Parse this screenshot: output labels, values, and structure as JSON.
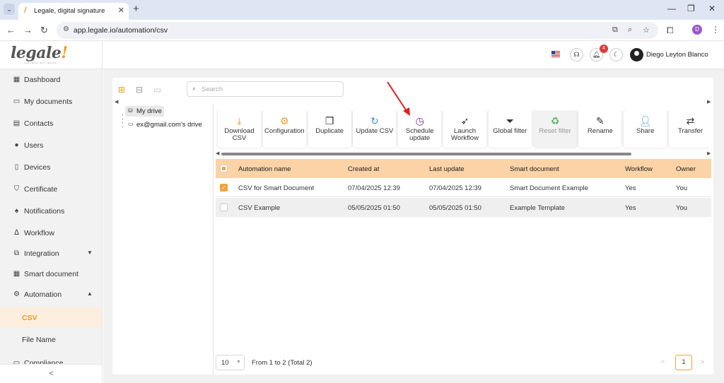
{
  "browser": {
    "tab_title": "Legale, digital signature",
    "url": "app.legale.io/automation/csv",
    "profile_initial": "D"
  },
  "header": {
    "logo_text": "legale",
    "logo_tagline": "THE LEGAL WAY LEGALE",
    "notification_count": "4",
    "user_name": "Diego Leyton Blanco"
  },
  "sidebar": {
    "items": [
      {
        "label": "Dashboard",
        "icon": "dashboard-icon"
      },
      {
        "label": "My documents",
        "icon": "folder-icon"
      },
      {
        "label": "Contacts",
        "icon": "contacts-icon"
      },
      {
        "label": "Users",
        "icon": "user-icon"
      },
      {
        "label": "Devices",
        "icon": "device-icon"
      },
      {
        "label": "Certificate",
        "icon": "shield-icon"
      },
      {
        "label": "Notifications",
        "icon": "bell-icon"
      },
      {
        "label": "Workflow",
        "icon": "workflow-icon"
      },
      {
        "label": "Integration",
        "icon": "integration-icon"
      },
      {
        "label": "Smart document",
        "icon": "smart-document-icon"
      },
      {
        "label": "Automation",
        "icon": "gear-icon"
      }
    ],
    "sub_items": [
      {
        "label": "CSV",
        "active": true
      },
      {
        "label": "File Name",
        "active": false
      }
    ],
    "last_item": "Compliance",
    "collapse_glyph": "<"
  },
  "main": {
    "search_placeholder": "Search",
    "tree": {
      "root": "My drive",
      "child": "ex@gmail.com's drive"
    },
    "toolbar": [
      {
        "label": "Download CSV",
        "icon": "download-icon",
        "color": "#f29a1f",
        "enabled": true
      },
      {
        "label": "Configuration",
        "icon": "settings-icon",
        "color": "#f29a1f",
        "enabled": true
      },
      {
        "label": "Duplicate",
        "icon": "copy-icon",
        "color": "#333333",
        "enabled": true
      },
      {
        "label": "Update CSV",
        "icon": "refresh-icon",
        "color": "#3a8fd6",
        "enabled": true
      },
      {
        "label": "Schedule update",
        "icon": "schedule-icon",
        "color": "#7a2a9c",
        "enabled": true
      },
      {
        "label": "Launch Workflow",
        "icon": "rocket-icon",
        "color": "#333333",
        "enabled": true
      },
      {
        "label": "Global filter",
        "icon": "filter-icon",
        "color": "#333333",
        "enabled": true
      },
      {
        "label": "Reset filter",
        "icon": "recycle-icon",
        "color": "#5ab55e",
        "enabled": false
      },
      {
        "label": "Rename",
        "icon": "pencil-icon",
        "color": "#333333",
        "enabled": true
      },
      {
        "label": "Share",
        "icon": "add-user-icon",
        "color": "#3a8fd6",
        "enabled": true
      },
      {
        "label": "Transfer",
        "icon": "transfer-icon",
        "color": "#333333",
        "enabled": true
      }
    ],
    "table": {
      "columns": [
        "Automation name",
        "Created at",
        "Last update",
        "Smart document",
        "Workflow",
        "Owner"
      ],
      "rows": [
        {
          "name": "CSV for Smart Document",
          "created": "07/04/2025 12:39",
          "updated": "07/04/2025 12:39",
          "smart_document": "Smart Document Example",
          "workflow": "Yes",
          "owner": "You",
          "checked": true
        },
        {
          "name": "CSV Example",
          "created": "05/05/2025 01:50",
          "updated": "05/05/2025 01:50",
          "smart_document": "Example Template",
          "workflow": "Yes",
          "owner": "You",
          "checked": false
        }
      ]
    },
    "pagination": {
      "page_size": "10",
      "info": "From 1 to 2 (Total 2)",
      "current_page": "1"
    }
  },
  "colors": {
    "accent": "#f29a1f",
    "header_row": "#fbd3a6",
    "annotation_arrow": "#e02020"
  }
}
